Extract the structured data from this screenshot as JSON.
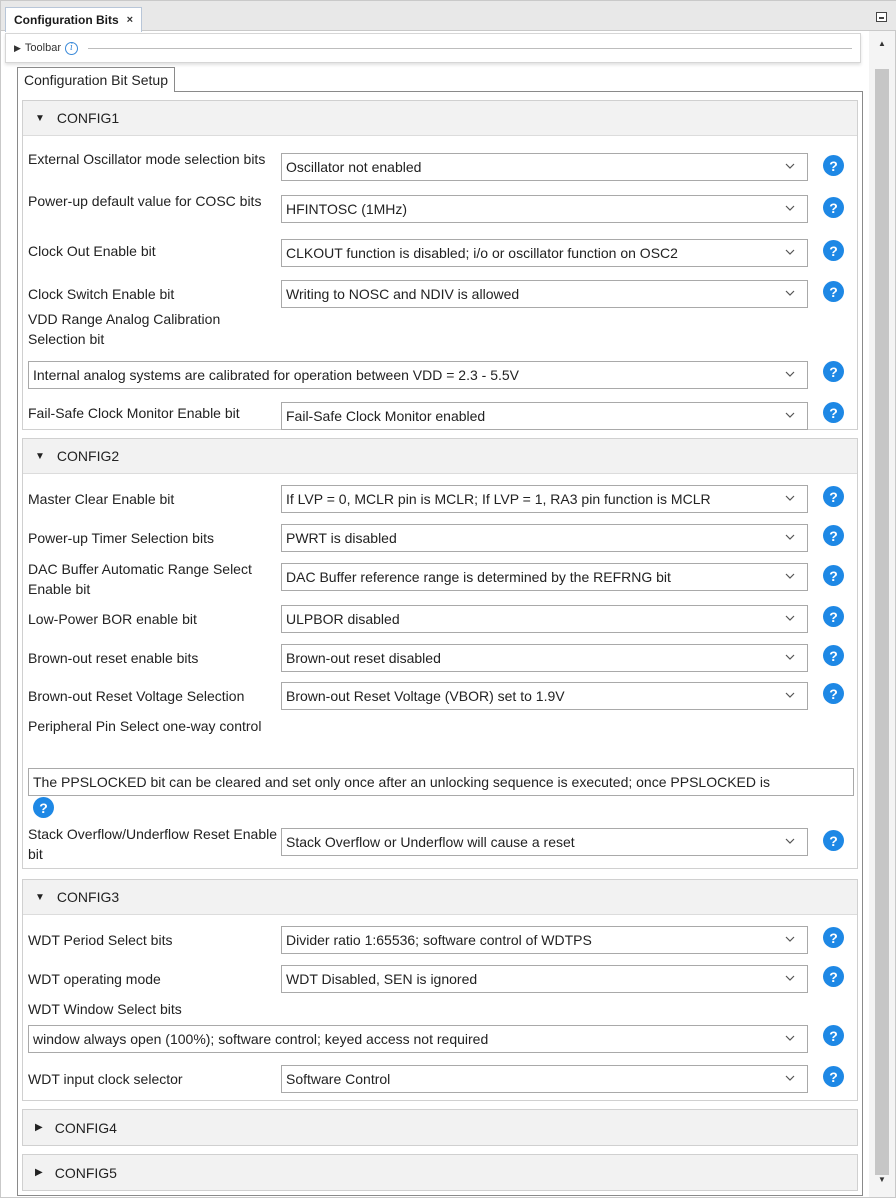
{
  "tab": {
    "title": "Configuration Bits",
    "close": "×"
  },
  "toolbar": {
    "label": "Toolbar",
    "info": "i"
  },
  "setup_tab": "Configuration Bit Setup",
  "help_glyph": "?",
  "sections": [
    {
      "title": "CONFIG1",
      "expanded": true,
      "settings": [
        {
          "label": "External Oscillator mode selection bits",
          "value": "Oscillator not enabled"
        },
        {
          "label": "Power-up default value for COSC bits",
          "value": "HFINTOSC (1MHz)"
        },
        {
          "label": "Clock Out Enable bit",
          "value": "CLKOUT function is disabled; i/o or oscillator function on OSC2"
        },
        {
          "label": "Clock Switch Enable bit",
          "value": "Writing to NOSC and NDIV is allowed"
        },
        {
          "label": "VDD Range Analog Calibration Selection bit",
          "value": "Internal analog systems are calibrated for operation between VDD = 2.3 - 5.5V"
        },
        {
          "label": "Fail-Safe Clock Monitor Enable bit",
          "value": "Fail-Safe Clock Monitor enabled"
        }
      ]
    },
    {
      "title": "CONFIG2",
      "expanded": true,
      "settings": [
        {
          "label": "Master Clear Enable bit",
          "value": "If LVP = 0, MCLR pin is MCLR; If LVP = 1, RA3 pin function is MCLR"
        },
        {
          "label": "Power-up Timer Selection bits",
          "value": "PWRT is disabled"
        },
        {
          "label": "DAC Buffer Automatic Range Select Enable bit",
          "value": "DAC Buffer reference range is determined by the REFRNG bit"
        },
        {
          "label": "Low-Power BOR enable bit",
          "value": "ULPBOR disabled"
        },
        {
          "label": "Brown-out reset enable bits",
          "value": "Brown-out reset disabled"
        },
        {
          "label": "Brown-out Reset Voltage Selection",
          "value": "Brown-out Reset Voltage (VBOR) set to 1.9V"
        },
        {
          "label": "Peripheral Pin Select one-way control",
          "value": "The PPSLOCKED bit can be cleared and set only once after an unlocking sequence is executed; once PPSLOCKED is"
        },
        {
          "label": "Stack Overflow/Underflow Reset Enable bit",
          "value": "Stack Overflow or Underflow will cause a reset"
        }
      ]
    },
    {
      "title": "CONFIG3",
      "expanded": true,
      "settings": [
        {
          "label": "WDT Period Select bits",
          "value": "Divider ratio 1:65536; software control of WDTPS"
        },
        {
          "label": "WDT operating mode",
          "value": "WDT Disabled, SEN is ignored"
        },
        {
          "label": "WDT Window Select bits",
          "value": "window always open (100%); software control; keyed access not required"
        },
        {
          "label": "WDT input clock selector",
          "value": "Software Control"
        }
      ]
    },
    {
      "title": "CONFIG4",
      "expanded": false,
      "settings": []
    },
    {
      "title": "CONFIG5",
      "expanded": false,
      "settings": []
    }
  ]
}
